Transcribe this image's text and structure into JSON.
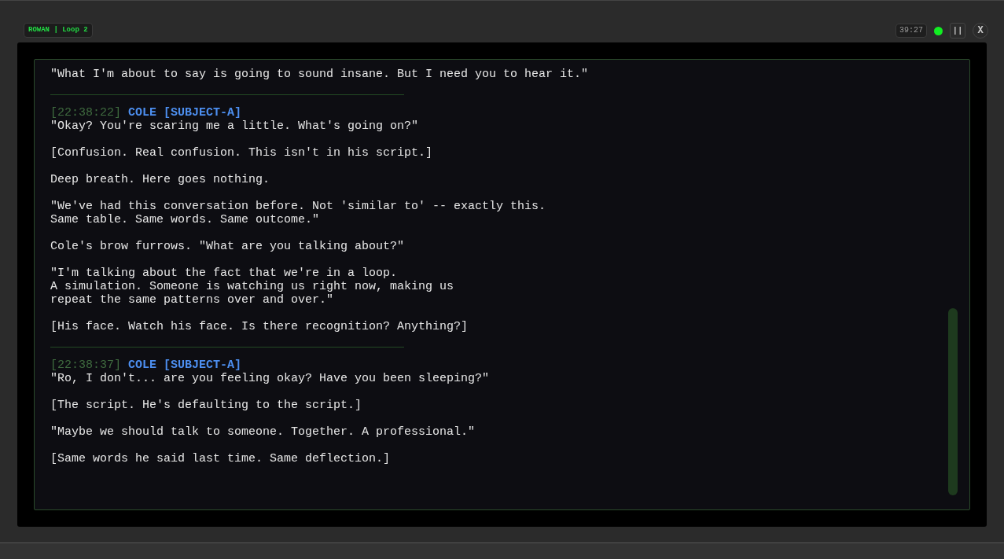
{
  "header": {
    "session_label": "ROWAN | Loop 2",
    "timer": "39:27",
    "status_on": true,
    "pause_button": "||",
    "close_button": "X"
  },
  "transcript": [
    {
      "kind": "narration",
      "paragraphs": [
        [
          "\"What I'm about to say is going to sound insane. But I need you to hear it.\""
        ]
      ]
    },
    {
      "kind": "message",
      "timestamp": "[22:38:22]",
      "speaker": "COLE [SUBJECT-A]",
      "paragraphs": [
        [
          "\"Okay? You're scaring me a little. What's going on?\""
        ],
        [
          "[Confusion. Real confusion. This isn't in his script.]"
        ]
      ]
    },
    {
      "kind": "narration",
      "paragraphs": [
        [
          "Deep breath. Here goes nothing."
        ],
        [
          "\"We've had this conversation before. Not 'similar to' -- exactly this.",
          "Same table. Same words. Same outcome.\""
        ],
        [
          "Cole's brow furrows. \"What are you talking about?\""
        ],
        [
          "\"I'm talking about the fact that we're in a loop.",
          "A simulation. Someone is watching us right now, making us",
          "repeat the same patterns over and over.\""
        ],
        [
          "[His face. Watch his face. Is there recognition? Anything?]"
        ]
      ]
    },
    {
      "kind": "message",
      "timestamp": "[22:38:37]",
      "speaker": "COLE [SUBJECT-A]",
      "paragraphs": [
        [
          "\"Ro, I don't... are you feeling okay? Have you been sleeping?\""
        ],
        [
          "[The script. He's defaulting to the script.]"
        ],
        [
          "\"Maybe we should talk to someone. Together. A professional.\""
        ],
        [
          "[Same words he said last time. Same deflection.]"
        ]
      ]
    }
  ]
}
